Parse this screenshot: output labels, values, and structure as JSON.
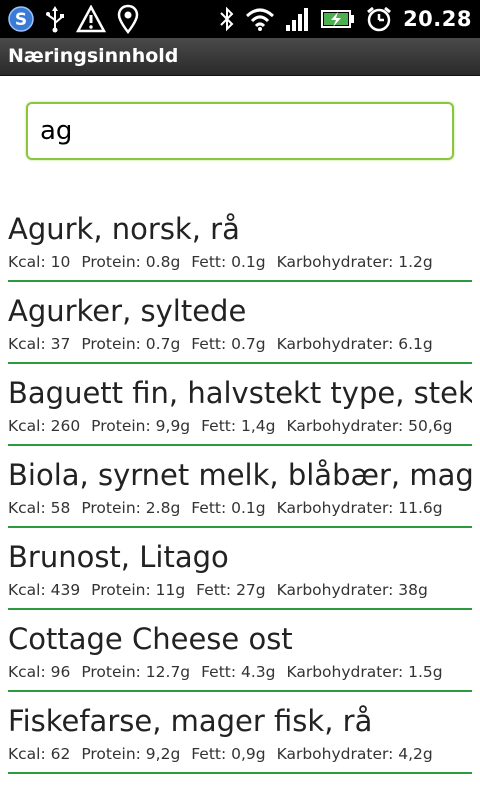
{
  "status_bar": {
    "time": "20.28",
    "icons_left": [
      "app-s-icon",
      "usb-icon",
      "warning-icon",
      "location-icon"
    ],
    "icons_right": [
      "bluetooth-icon",
      "wifi-icon",
      "signal-icon",
      "battery-charging-icon",
      "alarm-icon"
    ]
  },
  "app": {
    "title": "Næringsinnhold"
  },
  "search": {
    "value": "ag"
  },
  "colors": {
    "accent_green": "#8cc63f",
    "divider_green": "#2e9a3e"
  },
  "items": [
    {
      "name": "Agurk, norsk, rå",
      "kcal": "Kcal: 10",
      "protein": "Protein: 0.8g",
      "fett": "Fett: 0.1g",
      "karbo": "Karbohydrater: 1.2g"
    },
    {
      "name": "Agurker, syltede",
      "kcal": "Kcal: 37",
      "protein": "Protein: 0.7g",
      "fett": "Fett: 0.7g",
      "karbo": "Karbohydrater: 6.1g"
    },
    {
      "name": "Baguett fin, halvstekt type, stekt",
      "kcal": "Kcal: 260",
      "protein": "Protein: 9,9g",
      "fett": "Fett: 1,4g",
      "karbo": "Karbohydrater: 50,6g"
    },
    {
      "name": "Biola, syrnet melk, blåbær, mager",
      "kcal": "Kcal: 58",
      "protein": "Protein: 2.8g",
      "fett": "Fett: 0.1g",
      "karbo": "Karbohydrater: 11.6g"
    },
    {
      "name": "Brunost, Litago",
      "kcal": "Kcal: 439",
      "protein": "Protein: 11g",
      "fett": "Fett: 27g",
      "karbo": "Karbohydrater: 38g"
    },
    {
      "name": "Cottage Cheese ost",
      "kcal": "Kcal: 96",
      "protein": "Protein: 12.7g",
      "fett": "Fett: 4.3g",
      "karbo": "Karbohydrater: 1.5g"
    },
    {
      "name": "Fiskefarse, mager fisk, rå",
      "kcal": "Kcal: 62",
      "protein": "Protein: 9,2g",
      "fett": "Fett: 0,9g",
      "karbo": "Karbohydrater: 4,2g"
    }
  ]
}
